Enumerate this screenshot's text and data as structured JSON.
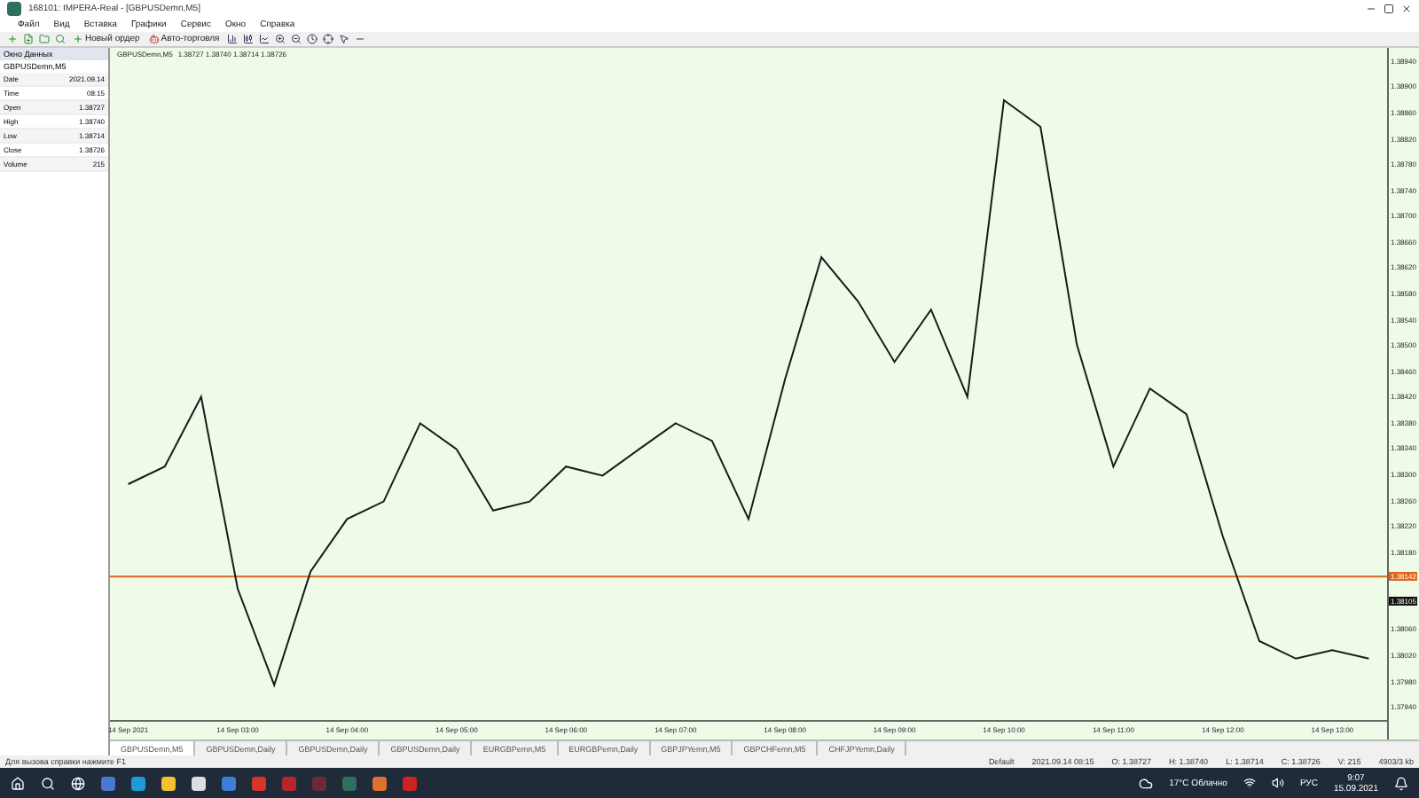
{
  "window": {
    "title": "168101: IMPERA-Real - [GBPUSDemn,M5]"
  },
  "menu": [
    "Файл",
    "Вид",
    "Вставка",
    "Графики",
    "Сервис",
    "Окно",
    "Справка"
  ],
  "toolbar": {
    "buttons": [
      {
        "label": "Новый ордер"
      },
      {
        "label": "Авто-торговля"
      }
    ]
  },
  "data_window": {
    "title": "Окно Данных",
    "symbol": "GBPUSDemn,M5",
    "rows": [
      {
        "label": "Date",
        "value": "2021.09.14"
      },
      {
        "label": "Time",
        "value": "08:15"
      },
      {
        "label": "Open",
        "value": "1.38727"
      },
      {
        "label": "High",
        "value": "1.38740"
      },
      {
        "label": "Low",
        "value": "1.38714"
      },
      {
        "label": "Close",
        "value": "1.38726"
      },
      {
        "label": "Volume",
        "value": "215"
      }
    ]
  },
  "chart": {
    "header": "1.38727 1.38740 1.38714 1.38726",
    "price_tags": [
      {
        "kind": "bid",
        "text": "1.38142"
      },
      {
        "kind": "last",
        "text": "1.38105"
      }
    ],
    "chart_data": {
      "type": "line",
      "categories": [
        "14 Sep 2021",
        null,
        null,
        "14 Sep 03:00",
        null,
        null,
        "14 Sep 04:00",
        null,
        null,
        "14 Sep 05:00",
        null,
        null,
        "14 Sep 06:00",
        null,
        null,
        "14 Sep 07:00",
        null,
        null,
        "14 Sep 08:00",
        null,
        null,
        "14 Sep 09:00",
        null,
        null,
        "14 Sep 10:00",
        null,
        null,
        "14 Sep 11:00",
        null,
        null,
        "14 Sep 12:00",
        null,
        null,
        "14 Sep 13:00",
        null
      ],
      "series": [
        {
          "name": "GBPUSDemn,M5",
          "color": "#1a1a1a",
          "values": [
            1.38285,
            1.38312,
            1.3842,
            1.38123,
            1.37974,
            1.3815,
            1.38231,
            1.38258,
            1.38379,
            1.38339,
            1.38244,
            1.38258,
            1.38312,
            1.38298,
            1.38339,
            1.38379,
            1.38352,
            1.38231,
            1.38447,
            1.38636,
            1.38568,
            1.38474,
            1.38555,
            1.3842,
            1.38879,
            1.38838,
            1.38501,
            1.38312,
            1.38433,
            1.38393,
            1.38204,
            1.38042,
            1.38015,
            1.38028,
            1.38015
          ]
        }
      ],
      "ylim": [
        1.3792,
        1.3896
      ],
      "ref_lines": [
        {
          "axis": "y",
          "value": 1.38142,
          "color": "#e0661e"
        }
      ],
      "yticks": [
        {
          "value": 1.3794,
          "label": "1.37940"
        },
        {
          "value": 1.3798,
          "label": "1.37980"
        },
        {
          "value": 1.3802,
          "label": "1.38020"
        },
        {
          "value": 1.3806,
          "label": "1.38060"
        },
        {
          "value": 1.3818,
          "label": "1.38180"
        },
        {
          "value": 1.3822,
          "label": "1.38220"
        },
        {
          "value": 1.3826,
          "label": "1.38260"
        },
        {
          "value": 1.383,
          "label": "1.38300"
        },
        {
          "value": 1.3834,
          "label": "1.38340"
        },
        {
          "value": 1.3838,
          "label": "1.38380"
        },
        {
          "value": 1.3842,
          "label": "1.38420"
        },
        {
          "value": 1.3846,
          "label": "1.38460"
        },
        {
          "value": 1.385,
          "label": "1.38500"
        },
        {
          "value": 1.3854,
          "label": "1.38540"
        },
        {
          "value": 1.3858,
          "label": "1.38580"
        },
        {
          "value": 1.3862,
          "label": "1.38620"
        },
        {
          "value": 1.3866,
          "label": "1.38660"
        },
        {
          "value": 1.387,
          "label": "1.38700"
        },
        {
          "value": 1.3874,
          "label": "1.38740"
        },
        {
          "value": 1.3878,
          "label": "1.38780"
        },
        {
          "value": 1.3882,
          "label": "1.38820"
        },
        {
          "value": 1.3886,
          "label": "1.38860"
        },
        {
          "value": 1.389,
          "label": "1.38900"
        },
        {
          "value": 1.3894,
          "label": "1.38940"
        }
      ]
    }
  },
  "chart_tabs": [
    {
      "label": "GBPUSDemn,M5",
      "selected": true
    },
    {
      "label": "GBPUSDemn,Daily",
      "selected": false
    },
    {
      "label": "GBPUSDemn,Daily",
      "selected": false
    },
    {
      "label": "GBPUSDemn,Daily",
      "selected": false
    },
    {
      "label": "EURGBPemn,M5",
      "selected": false
    },
    {
      "label": "EURGBPemn,Daily",
      "selected": false
    },
    {
      "label": "GBPJPYemn,M5",
      "selected": false
    },
    {
      "label": "GBPCHFemn,M5",
      "selected": false
    },
    {
      "label": "CHFJPYemn,Daily",
      "selected": false
    }
  ],
  "status_bar": {
    "help": "Для вызова справки нажмите F1",
    "profile": "Default",
    "datetime": "2021.09.14 08:15",
    "open": "O: 1.38727",
    "high": "H: 1.38740",
    "low": "L: 1.38714",
    "close": "C: 1.38726",
    "volume": "V: 215",
    "traffic": "4903/3 kb"
  },
  "taskbar": {
    "weather": "17°C Облачно",
    "language": "РУС",
    "time": "9:07",
    "date": "15.09.2021"
  }
}
